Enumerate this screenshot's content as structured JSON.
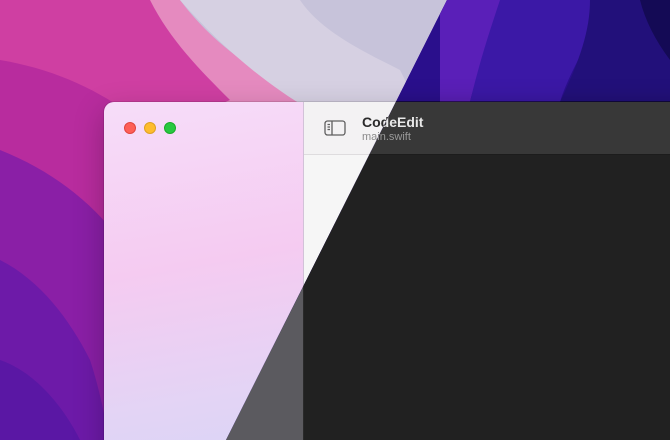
{
  "window": {
    "app_title": "CodeEdit",
    "file_name": "main.swift"
  },
  "toolbar": {
    "sidebar_toggle_icon": "sidebar-left-icon"
  },
  "traffic_lights": {
    "close_color": "#fe5f57",
    "minimize_color": "#febc2e",
    "zoom_color": "#28c840"
  },
  "theme": {
    "light_wallpaper_accent": "#d23fa0",
    "dark_wallpaper_accent": "#3a16a8",
    "dark_editor_bg": "#212121",
    "light_editor_bg": "#f6f6f6"
  }
}
